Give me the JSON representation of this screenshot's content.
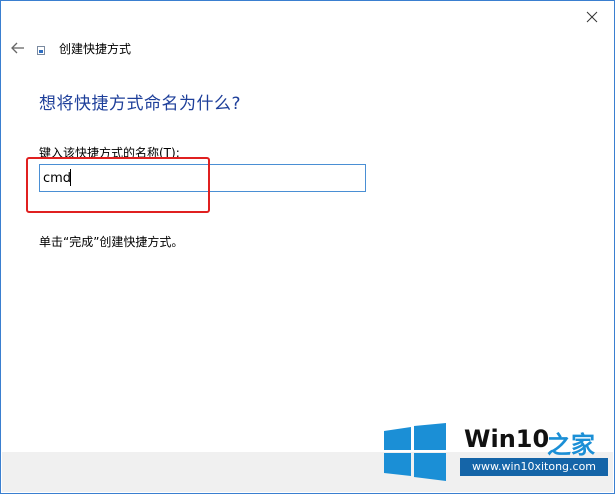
{
  "window": {
    "title": "创建快捷方式",
    "close_icon": "close-icon",
    "back_icon": "back-arrow-icon"
  },
  "main": {
    "heading": "想将快捷方式命名为什么?",
    "field_label": "键入该快捷方式的名称(T):",
    "name_value": "cmd",
    "hint": "单击“完成”创建快捷方式。"
  },
  "watermark": {
    "brand": "Win10",
    "brand_accent": "之家",
    "url": "www.win10xitong.com",
    "colors": {
      "blue": "#1b8fd6",
      "dark_blue": "#1565a8"
    }
  },
  "colors": {
    "heading": "#1e3f9a",
    "input_border": "#4a8fd4",
    "annotation_box": "#e02020",
    "footer": "#f0f0f0"
  }
}
